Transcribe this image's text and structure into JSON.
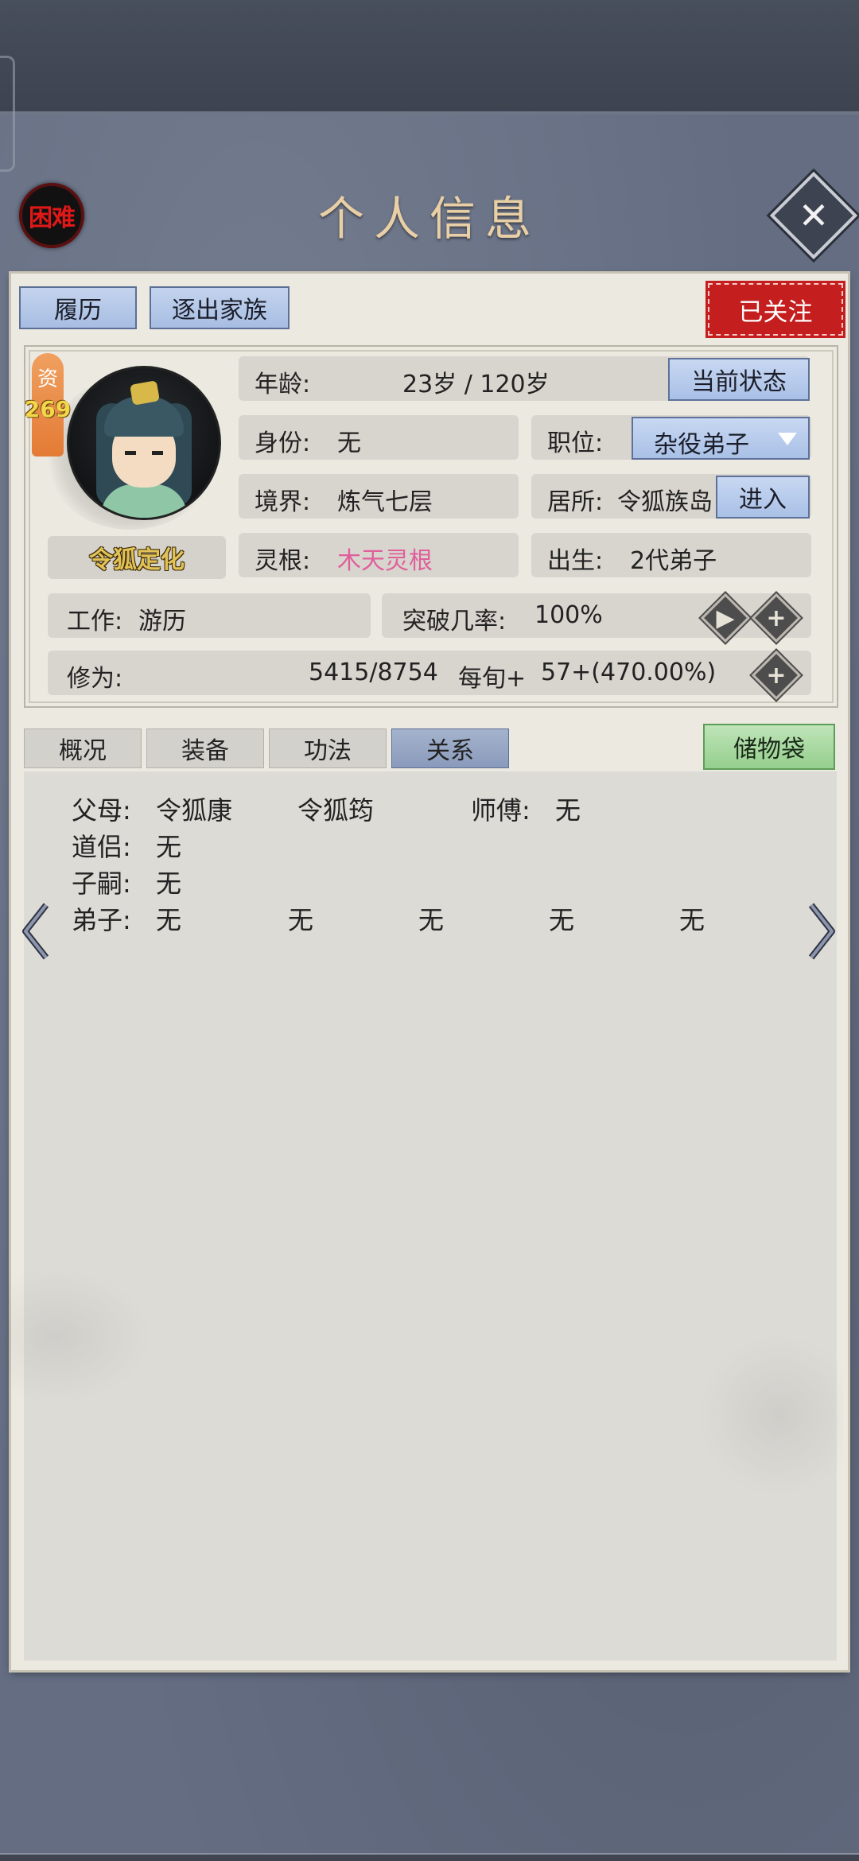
{
  "header": {
    "difficulty_label": "困难",
    "title": "个人信息",
    "close_icon": "close-icon"
  },
  "top_buttons": {
    "history": "履历",
    "expel": "逐出家族",
    "followed": "已关注"
  },
  "character": {
    "talent_char": "资",
    "talent_value": "269",
    "name": "令狐定化",
    "age_label": "年龄:",
    "age_value": "23岁 / 120岁",
    "current_state_button": "当前状态",
    "identity_label": "身份:",
    "identity_value": "无",
    "position_label": "职位:",
    "position_value": "杂役弟子",
    "realm_label": "境界:",
    "realm_value": "炼气七层",
    "residence_label": "居所:",
    "residence_value": "令狐族岛",
    "enter_button": "进入",
    "root_label": "灵根:",
    "root_value": "木天灵根",
    "root_color": "#e05f9a",
    "birth_label": "出生:",
    "birth_value": "2代弟子",
    "work_label": "工作:",
    "work_value": "游历",
    "breakthrough_label": "突破几率:",
    "breakthrough_value": "100%",
    "cultivation_label": "修为:",
    "cultivation_value": "5415/8754",
    "per_period_label": "每旬+",
    "per_period_value": "57+(470.00%)"
  },
  "tabs": [
    {
      "label": "概况",
      "active": false
    },
    {
      "label": "装备",
      "active": false
    },
    {
      "label": "功法",
      "active": false
    },
    {
      "label": "关系",
      "active": true
    }
  ],
  "storage_button": "储物袋",
  "relations": {
    "parents_label": "父母:",
    "parent1": "令狐康",
    "parent2": "令狐筠",
    "master_label": "师傅:",
    "master_value": "无",
    "partner_label": "道侣:",
    "partner_value": "无",
    "children_label": "子嗣:",
    "children_value": "无",
    "disciples_label": "弟子:",
    "disciples": [
      "无",
      "无",
      "无",
      "无",
      "无"
    ]
  },
  "colors": {
    "accent_blue": "#a9c0e6",
    "followed_red": "#c41e1e",
    "storage_green": "#95cf8d",
    "title_gold": "#e8cfa5"
  }
}
